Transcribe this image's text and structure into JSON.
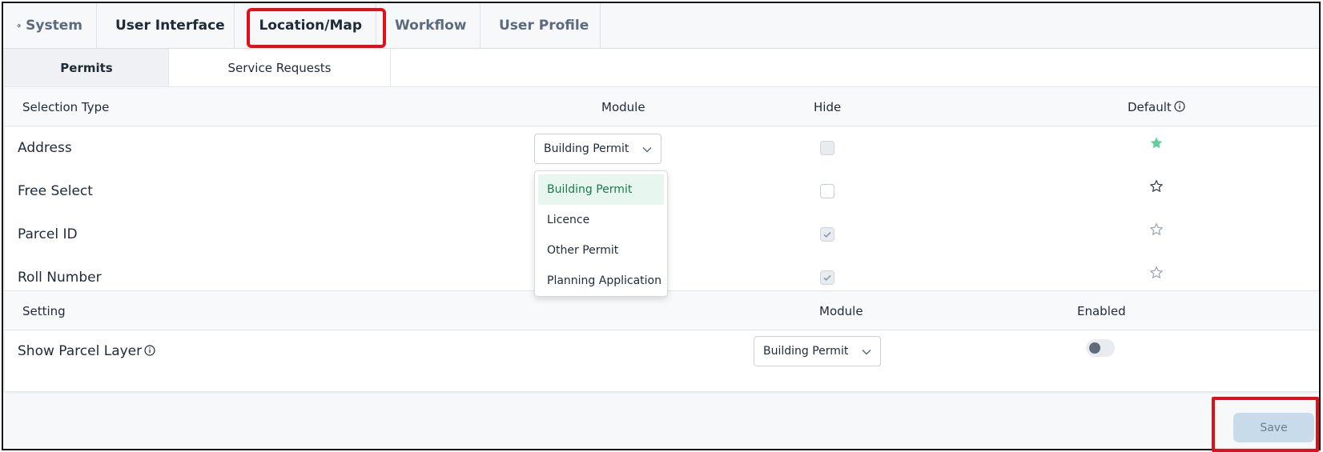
{
  "top_tabs": [
    {
      "label": "System",
      "icon": "gear-icon"
    },
    {
      "label": "User Interface",
      "icon": "pencil-icon"
    },
    {
      "label": "Location/Map",
      "icon": "globe-icon",
      "active": true
    },
    {
      "label": "Workflow",
      "icon": "sitemap-icon"
    },
    {
      "label": "User Profile",
      "icon": "user-icon"
    }
  ],
  "sub_tabs": [
    {
      "label": "Permits",
      "active": true
    },
    {
      "label": "Service Requests"
    }
  ],
  "selection_table": {
    "headers": {
      "selection_type": "Selection Type",
      "module": "Module",
      "hide": "Hide",
      "default": "Default"
    },
    "rows": [
      {
        "label": "Address",
        "module": "Building Permit",
        "hide": "unchecked-disabled",
        "default": true
      },
      {
        "label": "Free Select",
        "hide": "unchecked",
        "default": false
      },
      {
        "label": "Parcel ID",
        "hide": "checked-disabled",
        "default": false
      },
      {
        "label": "Roll Number",
        "hide": "checked-disabled",
        "default": false
      }
    ]
  },
  "module_dropdown": {
    "options": [
      "Building Permit",
      "Licence",
      "Other Permit",
      "Planning Application"
    ],
    "selected": "Building Permit"
  },
  "settings_table": {
    "headers": {
      "setting": "Setting",
      "module": "Module",
      "enabled": "Enabled"
    },
    "rows": [
      {
        "label": "Show Parcel Layer",
        "module": "Building Permit",
        "enabled": false
      }
    ]
  },
  "save_label": "Save",
  "colors": {
    "accent_green": "#5fcf9b",
    "highlight_red": "#e0101a",
    "save_bg": "#c7dbea"
  }
}
